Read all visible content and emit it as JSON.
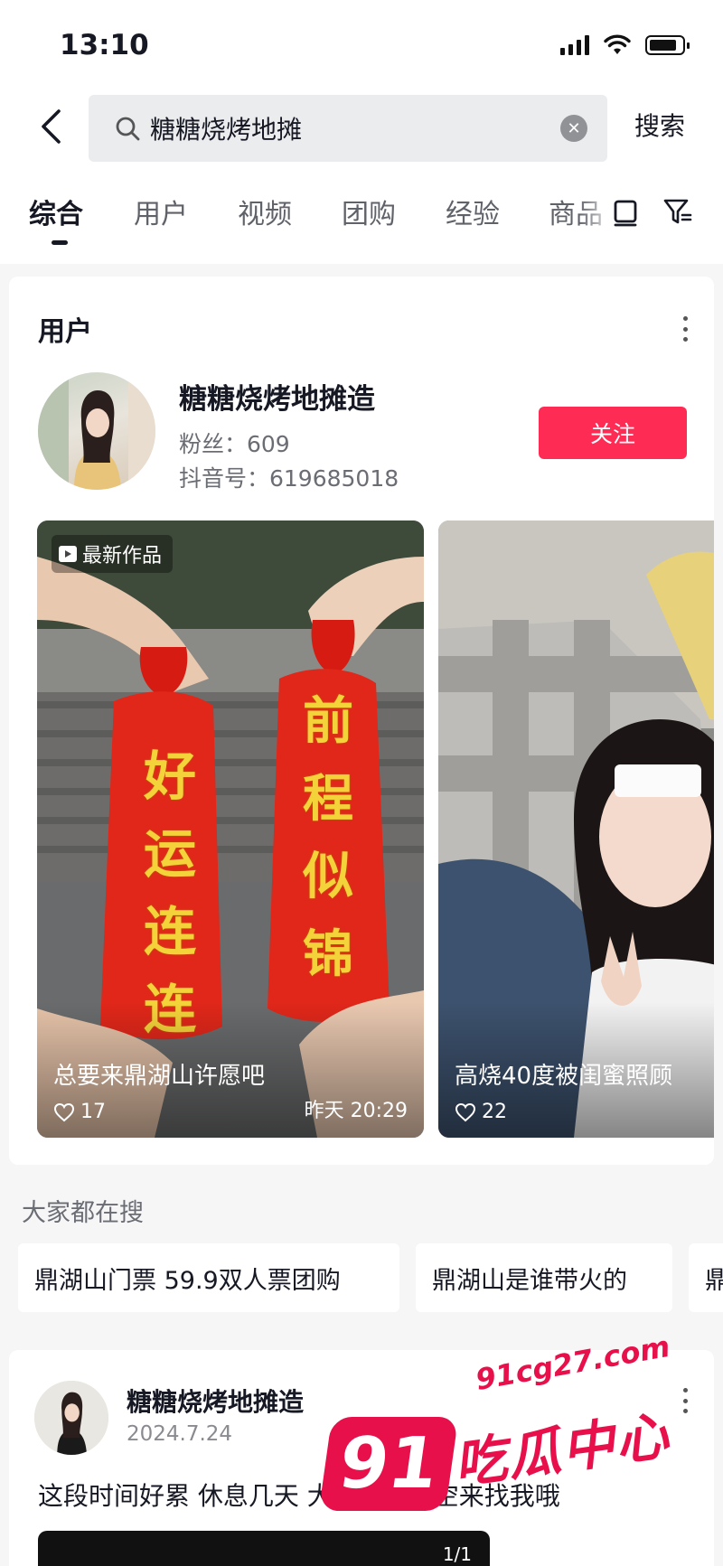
{
  "status_bar": {
    "time": "13:10",
    "battery_level": 0.85
  },
  "search": {
    "query": "糖糖烧烤地摊",
    "button_label": "搜索"
  },
  "tabs": [
    {
      "label": "综合",
      "active": true
    },
    {
      "label": "用户"
    },
    {
      "label": "视频"
    },
    {
      "label": "团购"
    },
    {
      "label": "经验"
    },
    {
      "label": "商品"
    }
  ],
  "user_section": {
    "title": "用户",
    "user": {
      "name": "糖糖烧烤地摊造",
      "fans": "粉丝：609",
      "douyin_id": "抖音号：619685018",
      "follow_label": "关注"
    },
    "works": [
      {
        "badge": "最新作品",
        "caption": "总要来鼎湖山许愿吧",
        "likes": "17",
        "time": "昨天 20:29",
        "banner_left": "好运连连",
        "banner_right": "前程似锦"
      },
      {
        "caption": "高烧40度被闺蜜照顾",
        "likes": "22"
      }
    ]
  },
  "hot_searches": {
    "title": "大家都在搜",
    "items": [
      "鼎湖山门票 59.9双人票团购",
      "鼎湖山是谁带火的",
      "鼎"
    ]
  },
  "post": {
    "author": "糖糖烧烤地摊造",
    "date": "2024.7.24",
    "text": "这段时间好累 休息几天 大家不要跑空来找我哦",
    "pager": "1/1"
  },
  "watermark": {
    "url": "91cg27.com",
    "logo": "91",
    "text": "吃瓜中心"
  },
  "colors": {
    "accent": "#fe2c55",
    "text_primary": "#161823",
    "text_secondary": "#6b6d74",
    "background": "#f6f6f7"
  }
}
